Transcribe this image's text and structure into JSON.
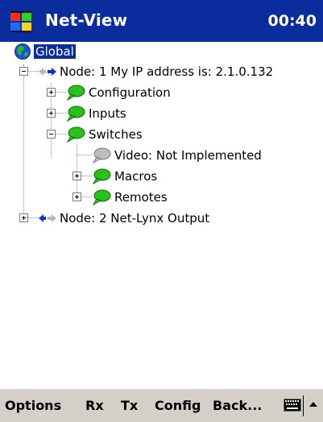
{
  "colors": {
    "title_bar": "#0a2c9c",
    "selection": "#0a2c9c",
    "menu_bar": "#d4d0c8",
    "node_icon_green": "#27c21c",
    "node_icon_gray": "#b0b0b0",
    "arrow_blue": "#1030d0"
  },
  "titlebar": {
    "start_icon": "windows-flag-icon",
    "app_title": "Net-View",
    "clock": "00:40"
  },
  "tree": {
    "root_label": "Global",
    "root_icon": "globe-icon",
    "node1_label": "Node: 1 My IP address is: 2.1.0.132",
    "node1_icon": "network-arrows-icon",
    "configuration_label": "Configuration",
    "inputs_label": "Inputs",
    "switches_label": "Switches",
    "video_label": "Video: Not Implemented",
    "macros_label": "Macros",
    "remotes_label": "Remotes",
    "node2_label": "Node: 2 Net-Lynx Output",
    "node2_icon": "network-arrows-icon",
    "item_icon": "speech-bubble-icon"
  },
  "menubar": {
    "options": "Options",
    "rx": "Rx",
    "tx": "Tx",
    "config": "Config",
    "back": "Back...",
    "keyboard_icon": "keyboard-icon",
    "sip_icon": "up-arrow-icon"
  }
}
